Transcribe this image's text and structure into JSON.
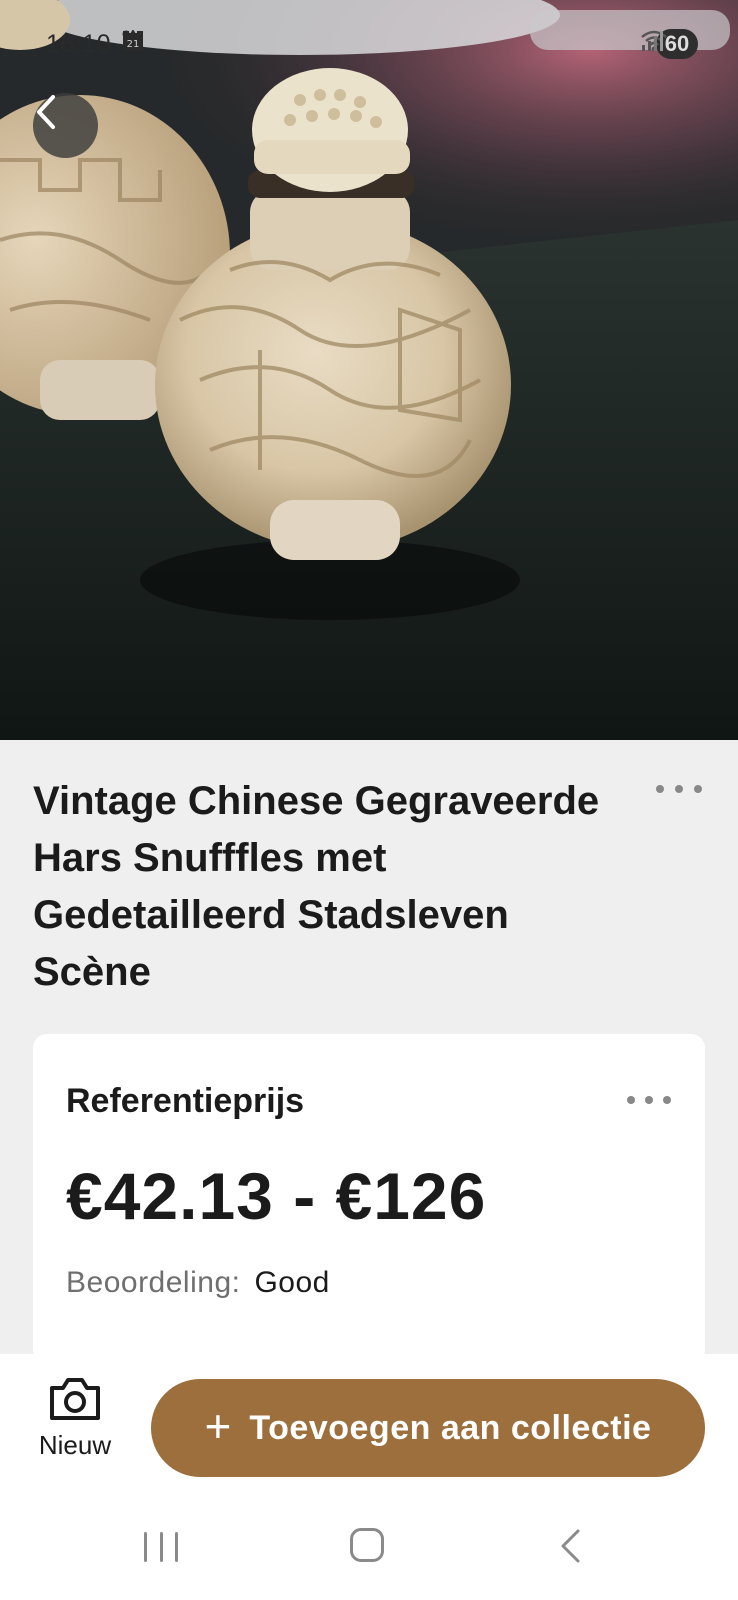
{
  "status_bar": {
    "time": "16:10",
    "icons_left": [
      "alert-icon",
      "screenshot-icon",
      "calendar-icon",
      "dot-icon"
    ],
    "calendar_day": "21",
    "icons_right": [
      "wifi-icon",
      "signal-icon"
    ],
    "battery": "60"
  },
  "hero": {
    "image_alt": "snuff-bottle-photo"
  },
  "product": {
    "title": "Vintage Chinese Gegraveerde Hars Snufffles met Gedetailleerd Stadsleven Scène"
  },
  "price_card": {
    "heading": "Referentieprijs",
    "price_range": "€42.13 - €126",
    "rating_label": "Beoordeling:",
    "rating_value": "Good"
  },
  "action_bar": {
    "new_label": "Nieuw",
    "add_plus": "+",
    "add_label": "Toevoegen aan collectie",
    "accent_color": "#9c6f3c"
  }
}
